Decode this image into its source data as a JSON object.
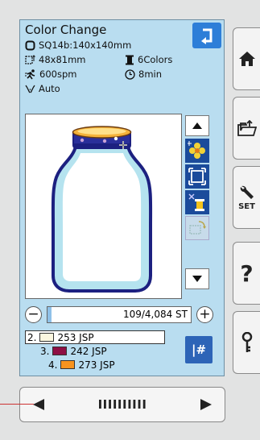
{
  "screen": {
    "title": "Color Change",
    "hoop": "SQ14b:140x140mm",
    "size": "48x81mm",
    "colors_count": "6Colors",
    "speed": "600spm",
    "time": "8min",
    "thread_trim": "Auto"
  },
  "stitch": {
    "counter": "109/4,084 ST",
    "progress_fraction": 0.027,
    "minus_label": "−",
    "plus_label": "+"
  },
  "color_list": [
    {
      "index": "2.",
      "code": "253 JSP",
      "color": "#fbf7e0"
    },
    {
      "index": "3.",
      "code": "242 JSP",
      "color": "#8e0f44"
    },
    {
      "index": "4.",
      "code": "273 JSP",
      "color": "#f7931e"
    }
  ],
  "jump_label": "|#",
  "bottom": {
    "stitch_bars": "IIIIIIIIII"
  },
  "accent": "#2d7ed8"
}
